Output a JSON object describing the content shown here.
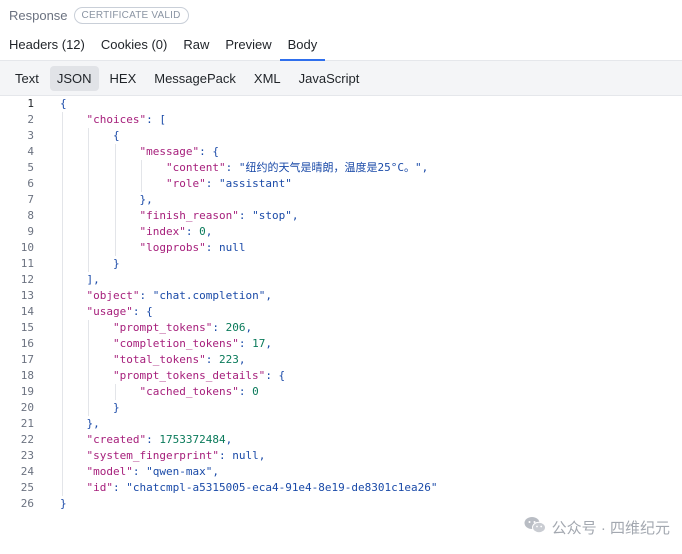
{
  "header": {
    "title": "Response",
    "badge": "CERTIFICATE VALID"
  },
  "tabs": [
    {
      "label": "Headers (12)"
    },
    {
      "label": "Cookies (0)"
    },
    {
      "label": "Raw"
    },
    {
      "label": "Preview"
    },
    {
      "label": "Body",
      "active": true
    }
  ],
  "format_tabs": [
    {
      "label": "Text"
    },
    {
      "label": "JSON",
      "active": true
    },
    {
      "label": "HEX"
    },
    {
      "label": "MessagePack"
    },
    {
      "label": "XML"
    },
    {
      "label": "JavaScript"
    }
  ],
  "code_lines": [
    [
      [
        "p",
        "{"
      ]
    ],
    [
      [
        "w",
        "    "
      ],
      [
        "k",
        "\"choices\""
      ],
      [
        "p",
        ": ["
      ]
    ],
    [
      [
        "w",
        "        "
      ],
      [
        "p",
        "{"
      ]
    ],
    [
      [
        "w",
        "            "
      ],
      [
        "k",
        "\"message\""
      ],
      [
        "p",
        ": {"
      ]
    ],
    [
      [
        "w",
        "                "
      ],
      [
        "k",
        "\"content\""
      ],
      [
        "p",
        ": "
      ],
      [
        "s",
        "\"纽约的天气是晴朗，温度是25°C。\""
      ],
      [
        "p",
        ","
      ]
    ],
    [
      [
        "w",
        "                "
      ],
      [
        "k",
        "\"role\""
      ],
      [
        "p",
        ": "
      ],
      [
        "s",
        "\"assistant\""
      ]
    ],
    [
      [
        "w",
        "            "
      ],
      [
        "p",
        "},"
      ]
    ],
    [
      [
        "w",
        "            "
      ],
      [
        "k",
        "\"finish_reason\""
      ],
      [
        "p",
        ": "
      ],
      [
        "s",
        "\"stop\""
      ],
      [
        "p",
        ","
      ]
    ],
    [
      [
        "w",
        "            "
      ],
      [
        "k",
        "\"index\""
      ],
      [
        "p",
        ": "
      ],
      [
        "n",
        "0"
      ],
      [
        "p",
        ","
      ]
    ],
    [
      [
        "w",
        "            "
      ],
      [
        "k",
        "\"logprobs\""
      ],
      [
        "p",
        ": "
      ],
      [
        "s",
        "null"
      ]
    ],
    [
      [
        "w",
        "        "
      ],
      [
        "p",
        "}"
      ]
    ],
    [
      [
        "w",
        "    "
      ],
      [
        "p",
        "],"
      ]
    ],
    [
      [
        "w",
        "    "
      ],
      [
        "k",
        "\"object\""
      ],
      [
        "p",
        ": "
      ],
      [
        "s",
        "\"chat.completion\""
      ],
      [
        "p",
        ","
      ]
    ],
    [
      [
        "w",
        "    "
      ],
      [
        "k",
        "\"usage\""
      ],
      [
        "p",
        ": {"
      ]
    ],
    [
      [
        "w",
        "        "
      ],
      [
        "k",
        "\"prompt_tokens\""
      ],
      [
        "p",
        ": "
      ],
      [
        "n",
        "206"
      ],
      [
        "p",
        ","
      ]
    ],
    [
      [
        "w",
        "        "
      ],
      [
        "k",
        "\"completion_tokens\""
      ],
      [
        "p",
        ": "
      ],
      [
        "n",
        "17"
      ],
      [
        "p",
        ","
      ]
    ],
    [
      [
        "w",
        "        "
      ],
      [
        "k",
        "\"total_tokens\""
      ],
      [
        "p",
        ": "
      ],
      [
        "n",
        "223"
      ],
      [
        "p",
        ","
      ]
    ],
    [
      [
        "w",
        "        "
      ],
      [
        "k",
        "\"prompt_tokens_details\""
      ],
      [
        "p",
        ": {"
      ]
    ],
    [
      [
        "w",
        "            "
      ],
      [
        "k",
        "\"cached_tokens\""
      ],
      [
        "p",
        ": "
      ],
      [
        "n",
        "0"
      ]
    ],
    [
      [
        "w",
        "        "
      ],
      [
        "p",
        "}"
      ]
    ],
    [
      [
        "w",
        "    "
      ],
      [
        "p",
        "},"
      ]
    ],
    [
      [
        "w",
        "    "
      ],
      [
        "k",
        "\"created\""
      ],
      [
        "p",
        ": "
      ],
      [
        "n",
        "1753372484"
      ],
      [
        "p",
        ","
      ]
    ],
    [
      [
        "w",
        "    "
      ],
      [
        "k",
        "\"system_fingerprint\""
      ],
      [
        "p",
        ": "
      ],
      [
        "s",
        "null"
      ],
      [
        "p",
        ","
      ]
    ],
    [
      [
        "w",
        "    "
      ],
      [
        "k",
        "\"model\""
      ],
      [
        "p",
        ": "
      ],
      [
        "s",
        "\"qwen-max\""
      ],
      [
        "p",
        ","
      ]
    ],
    [
      [
        "w",
        "    "
      ],
      [
        "k",
        "\"id\""
      ],
      [
        "p",
        ": "
      ],
      [
        "s",
        "\"chatcmpl-a5315005-eca4-91e4-8e19-de8301c1ea26\""
      ]
    ],
    [
      [
        "p",
        "}"
      ]
    ]
  ],
  "watermark": {
    "text": "公众号 · 四维纪元",
    "icon": "wechat-icon"
  }
}
